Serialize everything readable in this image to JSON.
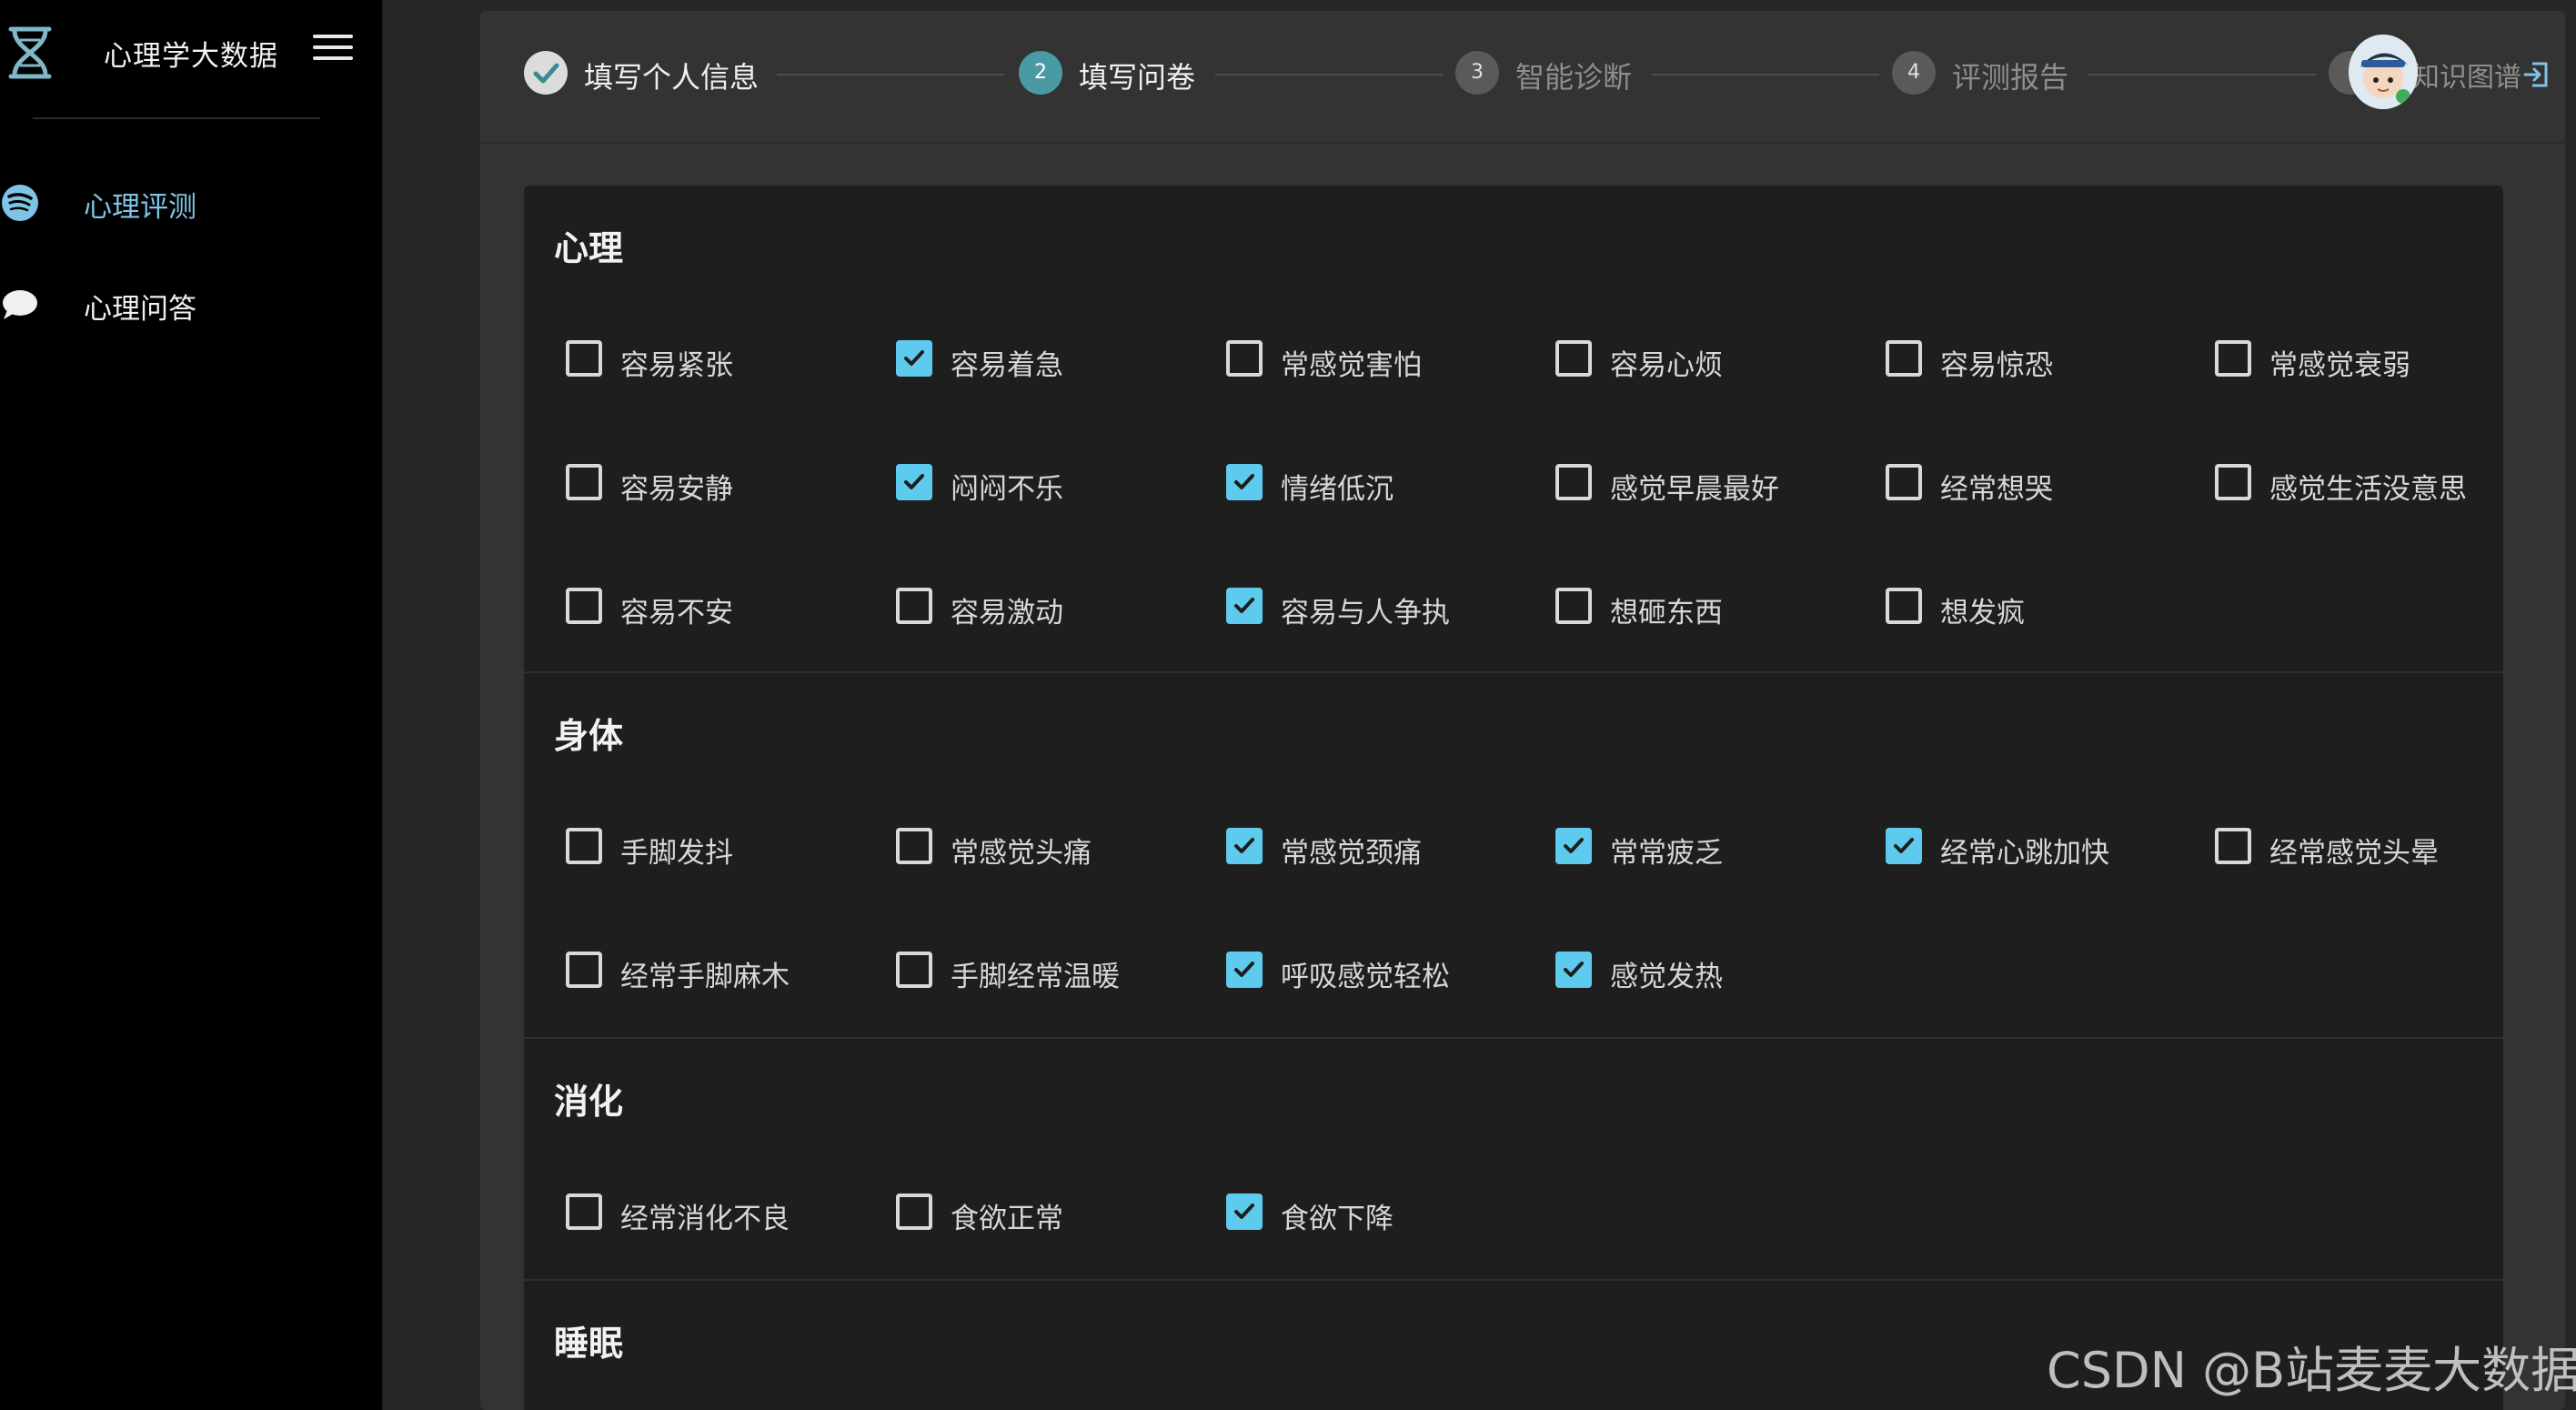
{
  "sidebar": {
    "title": "心理学大数据",
    "nav": [
      {
        "label": "心理评测",
        "active": true
      },
      {
        "label": "心理问答",
        "active": false
      }
    ]
  },
  "steps": [
    {
      "number": "",
      "label": "填写个人信息",
      "status": "done"
    },
    {
      "number": "2",
      "label": "填写问卷",
      "status": "current"
    },
    {
      "number": "3",
      "label": "智能诊断",
      "status": "pending"
    },
    {
      "number": "4",
      "label": "评测报告",
      "status": "pending"
    },
    {
      "number": "",
      "label": "知识图谱",
      "status": "pending"
    }
  ],
  "colors": {
    "accent": "#5ecbee",
    "active_nav": "#7fc4e6",
    "step_current": "#4a9aa3",
    "card_bg": "#1e1e1e",
    "panel_bg": "#333333"
  },
  "form": {
    "sections": [
      {
        "title": "心理",
        "rows": [
          [
            {
              "label": "容易紧张",
              "checked": false
            },
            {
              "label": "容易着急",
              "checked": true
            },
            {
              "label": "常感觉害怕",
              "checked": false
            },
            {
              "label": "容易心烦",
              "checked": false
            },
            {
              "label": "容易惊恐",
              "checked": false
            },
            {
              "label": "常感觉衰弱",
              "checked": false
            }
          ],
          [
            {
              "label": "容易安静",
              "checked": false
            },
            {
              "label": "闷闷不乐",
              "checked": true
            },
            {
              "label": "情绪低沉",
              "checked": true
            },
            {
              "label": "感觉早晨最好",
              "checked": false
            },
            {
              "label": "经常想哭",
              "checked": false
            },
            {
              "label": "感觉生活没意思",
              "checked": false
            }
          ],
          [
            {
              "label": "容易不安",
              "checked": false
            },
            {
              "label": "容易激动",
              "checked": false
            },
            {
              "label": "容易与人争执",
              "checked": true
            },
            {
              "label": "想砸东西",
              "checked": false
            },
            {
              "label": "想发疯",
              "checked": false
            }
          ]
        ]
      },
      {
        "title": "身体",
        "rows": [
          [
            {
              "label": "手脚发抖",
              "checked": false
            },
            {
              "label": "常感觉头痛",
              "checked": false
            },
            {
              "label": "常感觉颈痛",
              "checked": true
            },
            {
              "label": "常常疲乏",
              "checked": true
            },
            {
              "label": "经常心跳加快",
              "checked": true
            },
            {
              "label": "经常感觉头晕",
              "checked": false
            }
          ],
          [
            {
              "label": "经常手脚麻木",
              "checked": false
            },
            {
              "label": "手脚经常温暖",
              "checked": false
            },
            {
              "label": "呼吸感觉轻松",
              "checked": true
            },
            {
              "label": "感觉发热",
              "checked": true
            }
          ]
        ]
      },
      {
        "title": "消化",
        "rows": [
          [
            {
              "label": "经常消化不良",
              "checked": false
            },
            {
              "label": "食欲正常",
              "checked": false
            },
            {
              "label": "食欲下降",
              "checked": true
            }
          ]
        ]
      },
      {
        "title": "睡眠",
        "rows": []
      }
    ]
  },
  "watermark": "CSDN @B站麦麦大数据"
}
